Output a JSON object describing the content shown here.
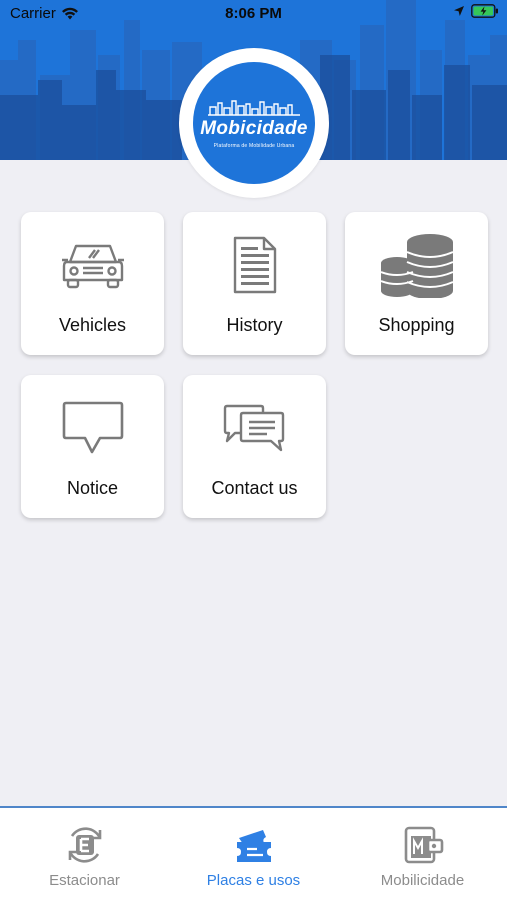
{
  "status_bar": {
    "carrier": "Carrier",
    "time": "8:06 PM"
  },
  "header": {
    "brand_color": "#1e74d9",
    "logo_text": "Mobicidade",
    "logo_subtitle": "Plataforma de Mobilidade Urbana"
  },
  "menu": {
    "items": [
      {
        "label": "Vehicles",
        "icon": "car-icon"
      },
      {
        "label": "History",
        "icon": "document-icon"
      },
      {
        "label": "Shopping",
        "icon": "coins-icon"
      },
      {
        "label": "Notice",
        "icon": "speech-bubble-icon"
      },
      {
        "label": "Contact us",
        "icon": "chat-bubbles-icon"
      }
    ]
  },
  "tab_bar": {
    "active_color": "#2f80e4",
    "inactive_color": "#8c8c8c",
    "tabs": [
      {
        "label": "Estacionar",
        "icon": "parking-e-icon",
        "active": false
      },
      {
        "label": "Placas e usos",
        "icon": "tickets-icon",
        "active": true
      },
      {
        "label": "Mobilicidade",
        "icon": "wallet-icon",
        "active": false
      }
    ]
  }
}
